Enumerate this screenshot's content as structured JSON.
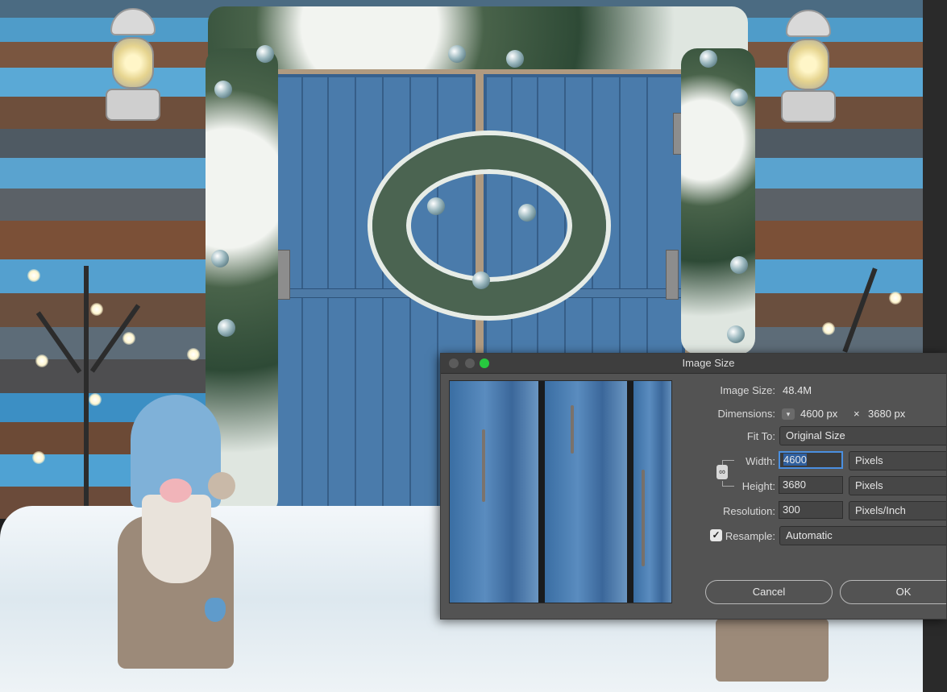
{
  "dialog": {
    "title": "Image Size",
    "image_size_label": "Image Size:",
    "image_size_value": "48.4M",
    "dimensions_label": "Dimensions:",
    "dimensions_width": "4600 px",
    "dimensions_times": "×",
    "dimensions_height": "3680 px",
    "fit_to_label": "Fit To:",
    "fit_to_value": "Original Size",
    "width_label": "Width:",
    "width_value": "4600",
    "width_unit": "Pixels",
    "height_label": "Height:",
    "height_value": "3680",
    "height_unit": "Pixels",
    "resolution_label": "Resolution:",
    "resolution_value": "300",
    "resolution_unit": "Pixels/Inch",
    "resample_label": "Resample:",
    "resample_checked": true,
    "resample_value": "Automatic",
    "cancel_label": "Cancel",
    "ok_label": "OK"
  },
  "icons": {
    "dimensions_toggle": "chevron-down-icon",
    "constrain": "link-icon",
    "resample_check": "checkmark-icon"
  },
  "colors": {
    "dialog_bg": "#535353",
    "titlebar_bg": "#3e3e3e",
    "focus_ring": "#4a8fe0",
    "close_light": "#5b5b5b",
    "zoom_light": "#27c93f"
  }
}
